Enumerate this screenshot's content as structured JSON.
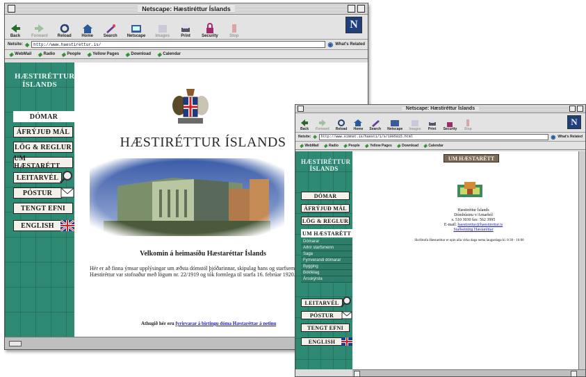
{
  "win1": {
    "title": "Netscape: Hæstiréttur Íslands",
    "toolbar": [
      "Back",
      "Forward",
      "Reload",
      "Home",
      "Search",
      "Netscape",
      "Images",
      "Print",
      "Security",
      "Stop"
    ],
    "location_label": "Netsite:",
    "url": "http://www.haestirettur.is/",
    "whats_related": "What's Related",
    "personal": [
      "WebMail",
      "Radio",
      "People",
      "Yellow Pages",
      "Download",
      "Calendar"
    ],
    "brand": "HÆSTIRÉTTUR ÍSLANDS",
    "nav": [
      "DÓMAR",
      "ÁFRÝJUÐ MÁL",
      "LÖG & REGLUR",
      "UM HÆSTARÉTT",
      "LEITARVÉL",
      "PÓSTUR",
      "TENGT EFNI",
      "ENGLISH"
    ],
    "heading": "HÆSTIRÉTTUR ÍSLANDS",
    "welcome": "Velkomin á heimasíðu Hæstaréttar Íslands",
    "intro": "Hér er að finna ýmsar upplýsingar um æðsta dómstól þjóðarinnar, skipulag hans og starfsemi. Hæstiréttur var stofnaður með lögum nr. 22/1919 og tók formlega til starfa 16. febrúar 1920.",
    "footer_prefix": "Athugið hér eru",
    "footer_link": "fyrirvarar á birtingu dóma Hæstaréttar á netinu"
  },
  "win2": {
    "title": "Netscape: Hæstiréttur Íslands",
    "toolbar": [
      "Back",
      "Forward",
      "Reload",
      "Home",
      "Search",
      "Netscape",
      "Images",
      "Print",
      "Security",
      "Stop"
    ],
    "location_label": "Netsite:",
    "url": "http://www.simnet.is/haesti/1/s/1995015.html",
    "whats_related": "What's Related",
    "personal": [
      "WebMail",
      "Radio",
      "People",
      "Yellow Pages",
      "Download",
      "Calendar"
    ],
    "brand": "HÆSTIRÉTTUR ÍSLANDS",
    "nav_top": [
      "DÓMAR",
      "ÁFRÝJUÐ MÁL",
      "LÖG & REGLUR",
      "UM HÆSTARÉTT"
    ],
    "subnav": [
      "Dómarar",
      "Aðrir starfsmenn",
      "Saga",
      "Fyrrverandi dómarar",
      "Bygging",
      "Bókfélag",
      "Ársskýrsla"
    ],
    "nav_bottom": [
      "LEITARVÉL",
      "PÓSTUR",
      "TENGT EFNI",
      "ENGLISH"
    ],
    "page_tab": "UM HÆSTARÉTT",
    "org": "Hæstiréttur Íslands",
    "address": "Dómhúsinu v/Arnarhól",
    "phone": "s. 510 3030 fax: 562 3995",
    "email_prefix": "E-mail:",
    "email": "haestirettur@haestirettur.is",
    "directions": "Staðsetning Hæstaréttar",
    "hours": "Skrifstofa Hæstaréttar er opin alla virka daga nema laugardaga kl. 8:30 - 16:00"
  },
  "colors": {
    "nav_green": "#2f8a74",
    "link_blue": "#1b1bb0",
    "netscape_blue": "#1f3f7a"
  }
}
